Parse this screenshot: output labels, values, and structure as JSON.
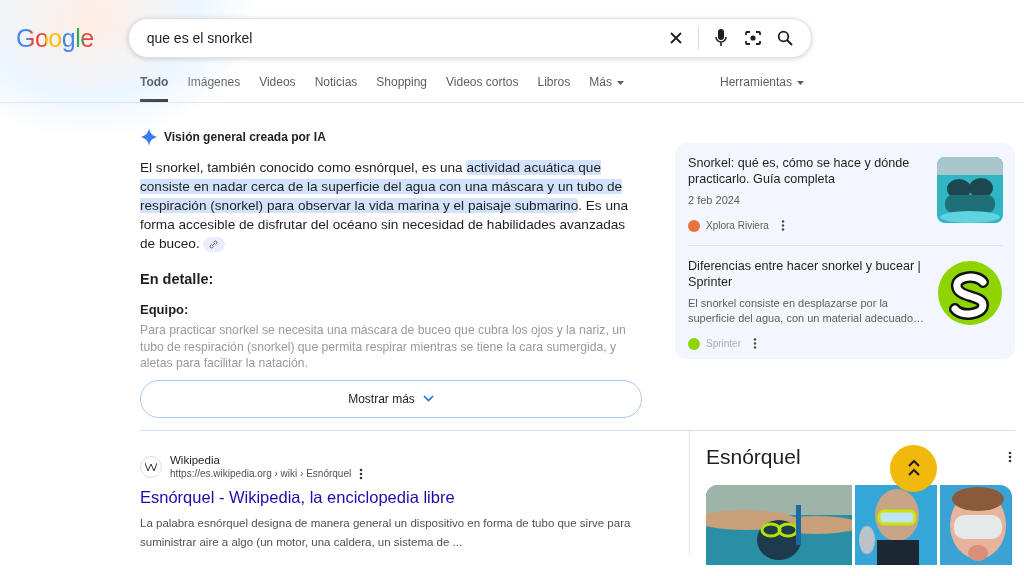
{
  "logo": "Google",
  "search": {
    "value": "que es el snorkel"
  },
  "tabs": [
    {
      "label": "Todo",
      "selected": true,
      "kind": "tab"
    },
    {
      "label": "Imágenes",
      "selected": false,
      "kind": "tab"
    },
    {
      "label": "Videos",
      "selected": false,
      "kind": "tab"
    },
    {
      "label": "Noticias",
      "selected": false,
      "kind": "tab"
    },
    {
      "label": "Shopping",
      "selected": false,
      "kind": "tab"
    },
    {
      "label": "Videos cortos",
      "selected": false,
      "kind": "tab"
    },
    {
      "label": "Libros",
      "selected": false,
      "kind": "tab"
    },
    {
      "label": "Más",
      "selected": false,
      "kind": "menu"
    }
  ],
  "tools": "Herramientas",
  "ai_overview": {
    "title": "Visión general creada por IA",
    "summary": [
      {
        "text": "El snorkel, también conocido como esnórquel, es una ",
        "highlighted": false
      },
      {
        "text": "actividad acuática que consiste en nadar cerca de la superficie del agua con una máscara y un tubo de respiración (snorkel) para observar la vida marina y el paisaje submarino",
        "highlighted": true
      },
      {
        "text": ". Es una forma accesible de disfrutar del océano sin necesidad de habilidades avanzadas de buceo.",
        "highlighted": false
      }
    ],
    "detail_heading": "En detalle:",
    "section_heading": "Equipo:",
    "section_text": "Para practicar snorkel se necesita una máscara de buceo que cubra los ojos y la nariz, un tubo de respiración (snorkel) que permita respirar mientras se tiene la cara sumergida, y aletas para facilitar la natación.",
    "show_more": "Mostrar más",
    "sources": [
      {
        "title": "Snorkel: qué es, cómo se hace y dónde practicarlo. Guía completa",
        "date": "2 feb 2024",
        "site": "Xplora Riviera",
        "color": "#e8743b"
      },
      {
        "title": "Diferencias entre hacer snorkel y bucear | Sprinter",
        "snippet": "El snorkel consiste en desplazarse por la superficie del agua, con un material adecuado…",
        "site": "Sprinter",
        "kind": "logo",
        "color": "#8fd400"
      }
    ]
  },
  "result": {
    "site": "Wikipedia",
    "url": "https://es.wikipedia.org › wiki › Esnórquel",
    "title": "Esnórquel - Wikipedia, la enciclopedia libre",
    "snippet": "La palabra esnórquel designa de manera general un dispositivo en forma de tubo que sirve para suministrar aire a algo (un motor, una caldera, un sistema de ..."
  },
  "knowledge_panel": {
    "title": "Esnórquel"
  }
}
